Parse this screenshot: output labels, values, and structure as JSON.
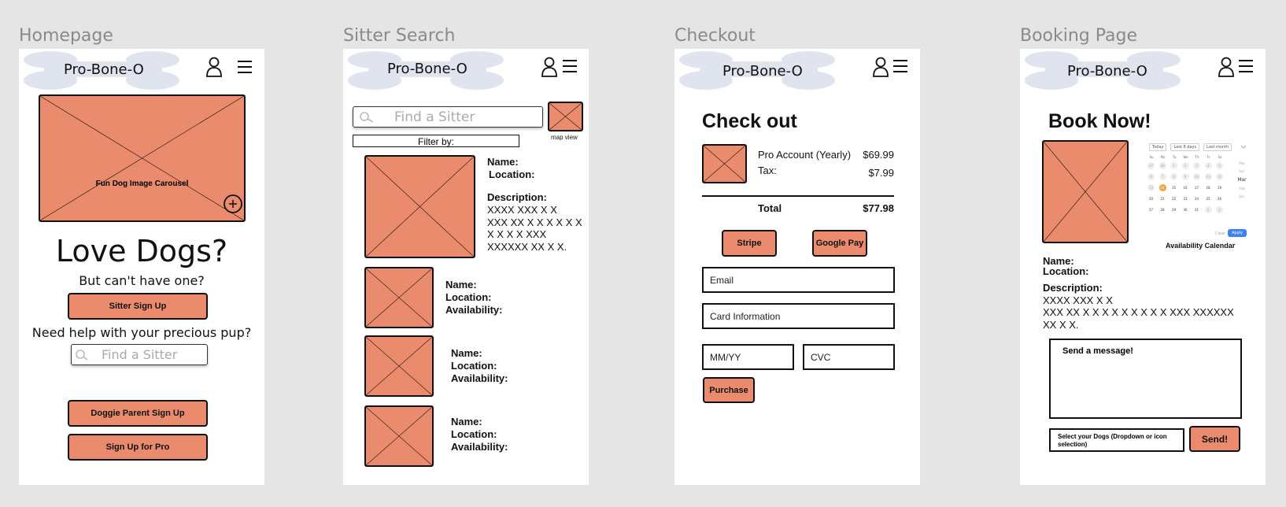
{
  "brand": "Pro-Bone-O",
  "frames": {
    "homepage": {
      "label": "Homepage",
      "carousel_caption": "Fun Dog Image Carousel",
      "headline": "Love Dogs?",
      "subheadline": "But can't have one?",
      "sitter_signup": "Sitter Sign Up",
      "help_text": "Need help with your precious pup?",
      "search_placeholder": "Find a Sitter",
      "parent_signup": "Doggie Parent Sign Up",
      "pro_signup": "Sign Up for Pro"
    },
    "sitter_search": {
      "label": "Sitter Search",
      "search_placeholder": "Find a Sitter",
      "map_view": "map view",
      "filter_by": "Filter by:",
      "featured": {
        "name": "Name:",
        "location": "Location:",
        "description_label": "Description:",
        "description_lines": [
          "XXXX XXX X X",
          "XXX XX X X X X X X",
          "X X X X XXX",
          "XXXXXX XX X X."
        ]
      },
      "results": [
        {
          "name": "Name:",
          "location": "Location:",
          "availability": "Availability:"
        },
        {
          "name": "Name:",
          "location": "Location:",
          "availability": "Availability:"
        },
        {
          "name": "Name:",
          "location": "Location:",
          "availability": "Availability:"
        }
      ]
    },
    "checkout": {
      "label": "Checkout",
      "title": "Check out",
      "item_name": "Pro Account (Yearly)",
      "item_price": "$69.99",
      "tax_label": "Tax:",
      "tax_price": "$7.99",
      "total_label": "Total",
      "total_price": "$77.98",
      "stripe": "Stripe",
      "google_pay": "Google Pay",
      "email": "Email",
      "card": "Card Information",
      "mmyy": "MM/YY",
      "cvc": "CVC",
      "purchase": "Purchase"
    },
    "booking": {
      "label": "Booking Page",
      "title": "Book Now!",
      "calendar_caption": "Availability Calendar",
      "calendar_presets": [
        "Today",
        "Last 8 days",
        "Last month"
      ],
      "weekdays": [
        "Su",
        "Mo",
        "Tu",
        "We",
        "Th",
        "Fr",
        "Sa"
      ],
      "calendar_rows": [
        [
          "27",
          "28",
          "1",
          "2",
          "3",
          "4",
          "5"
        ],
        [
          "6",
          "7",
          "8",
          "9",
          "10",
          "11",
          "12"
        ],
        [
          "13",
          "14",
          "15",
          "16",
          "17",
          "18",
          "19"
        ],
        [
          "20",
          "21",
          "22",
          "23",
          "24",
          "25",
          "26"
        ],
        [
          "27",
          "28",
          "29",
          "30",
          "31",
          "1",
          "2"
        ]
      ],
      "months": [
        "Mar",
        "Apr",
        "Mar",
        "Feb",
        "Jan"
      ],
      "clear": "Clear",
      "apply": "Apply",
      "name": "Name:",
      "location": "Location:",
      "description_label": "Description:",
      "description_lines": [
        "XXXX XXX X X",
        "XXX XX X X X X X X X X X XXX XXXXXX",
        "XX X X."
      ],
      "message_placeholder": "Send a message!",
      "dog_select": "Select your Dogs (Dropdown or icon selection)",
      "send": "Send!"
    }
  },
  "colors": {
    "placeholder": "#e98b6c",
    "logo_watermark": "#dfe4ef",
    "accent_blue": "#3b82f6",
    "selected_day": "#f2a23a"
  }
}
